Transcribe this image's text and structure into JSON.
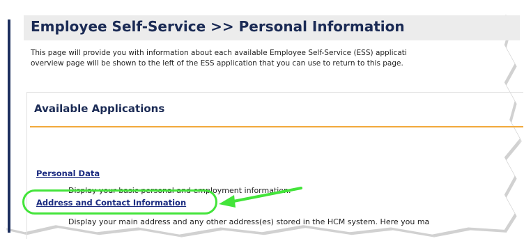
{
  "header": {
    "title": "Employee Self-Service >> Personal Information"
  },
  "intro": {
    "line1": "This page will provide you with information about each available Employee Self-Service (ESS) applicati",
    "line2": "overview page will be shown to the left of the ESS application that you can use to return to this page."
  },
  "available_applications": {
    "heading": "Available Applications",
    "items": [
      {
        "link": "Personal Data",
        "description": "Display your basic personal and employment information."
      },
      {
        "link": "Address and Contact Information",
        "description": "Display your main address and any other address(es) stored in the HCM system. Here you ma"
      }
    ]
  },
  "colors": {
    "title_navy": "#1b2b55",
    "link_blue": "#1b2b80",
    "divider_orange": "#f2a93b",
    "highlight_green": "#43e43a",
    "header_bg": "#ececec"
  },
  "icons": {
    "annotation_arrow": "green-arrow-icon",
    "annotation_ring": "green-highlight-ring"
  }
}
